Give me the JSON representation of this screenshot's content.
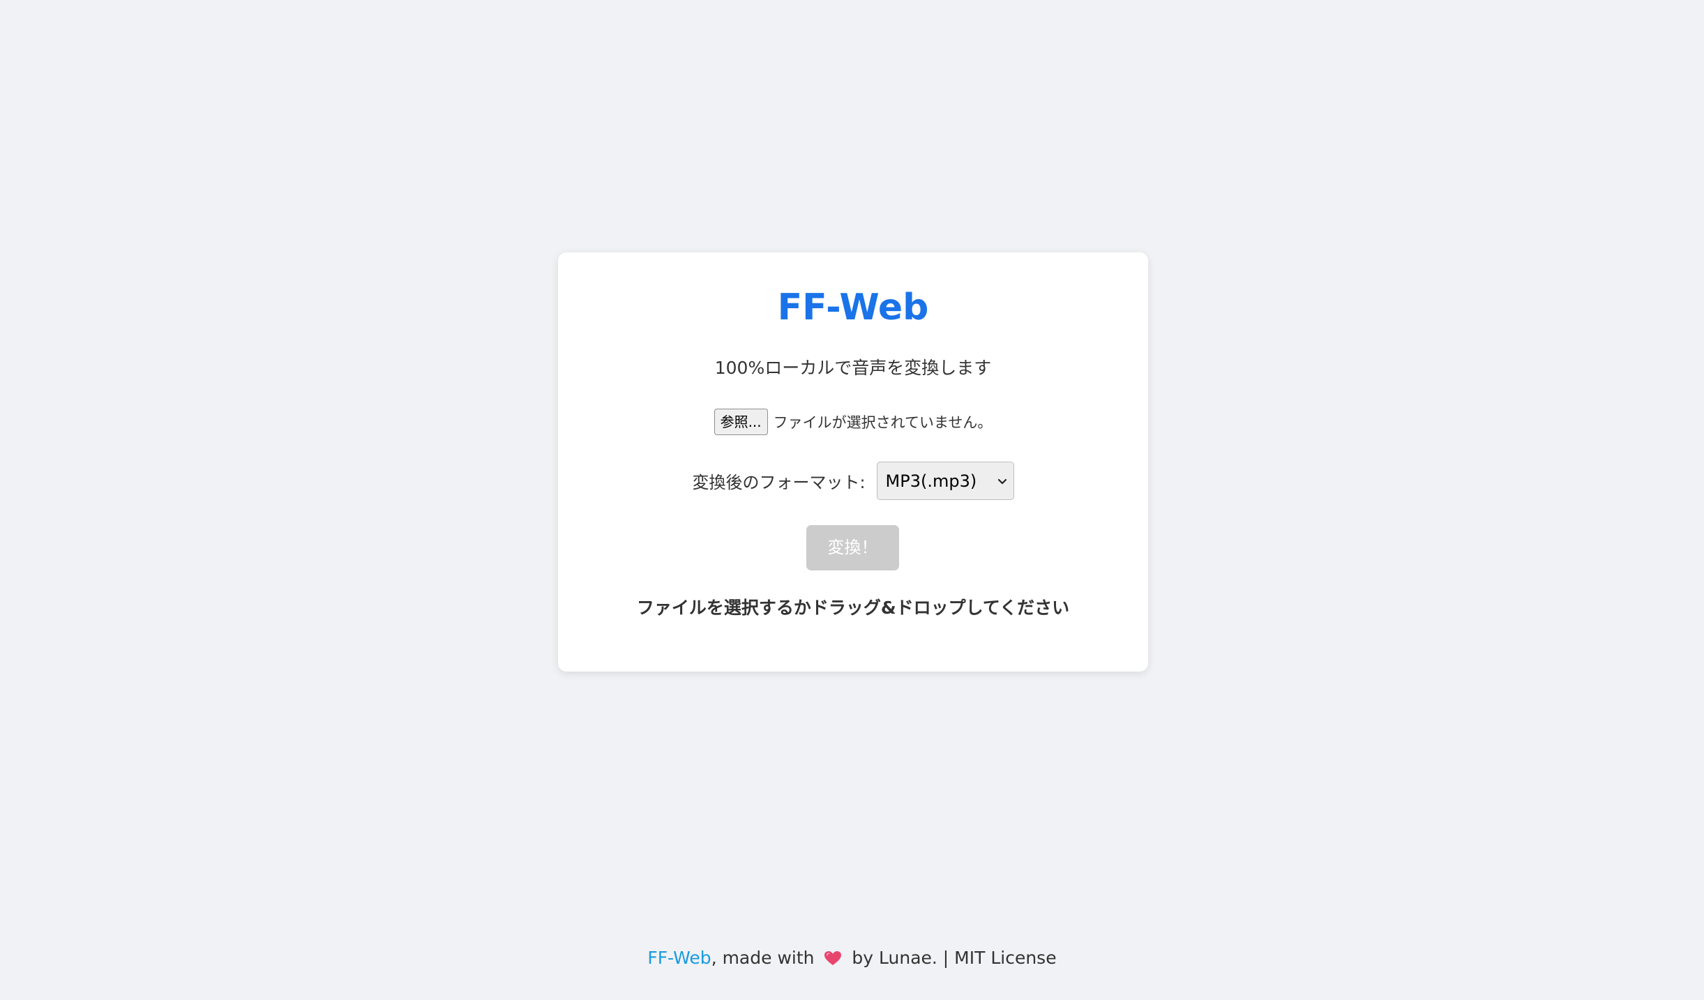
{
  "app": {
    "title": "FF-Web",
    "subtitle": "100%ローカルで音声を変換します"
  },
  "file_input": {
    "button_label": "参照...",
    "status": "ファイルが選択されていません。"
  },
  "format": {
    "label": "変換後のフォーマット:",
    "selected": "MP3(.mp3)"
  },
  "convert": {
    "label": "変換！",
    "disabled": true
  },
  "hint": "ファイルを選択するかドラッグ&ドロップしてください",
  "footer": {
    "link_text": "FF-Web",
    "made_with": ", made with",
    "by_text": "by Lunae. | MIT License",
    "heart_icon": "heart-icon"
  },
  "colors": {
    "background": "#f0f2f5",
    "accent": "#1a73e8",
    "link": "#1a9be0",
    "disabled_button": "#cccccc",
    "heart": "#e8456e"
  }
}
